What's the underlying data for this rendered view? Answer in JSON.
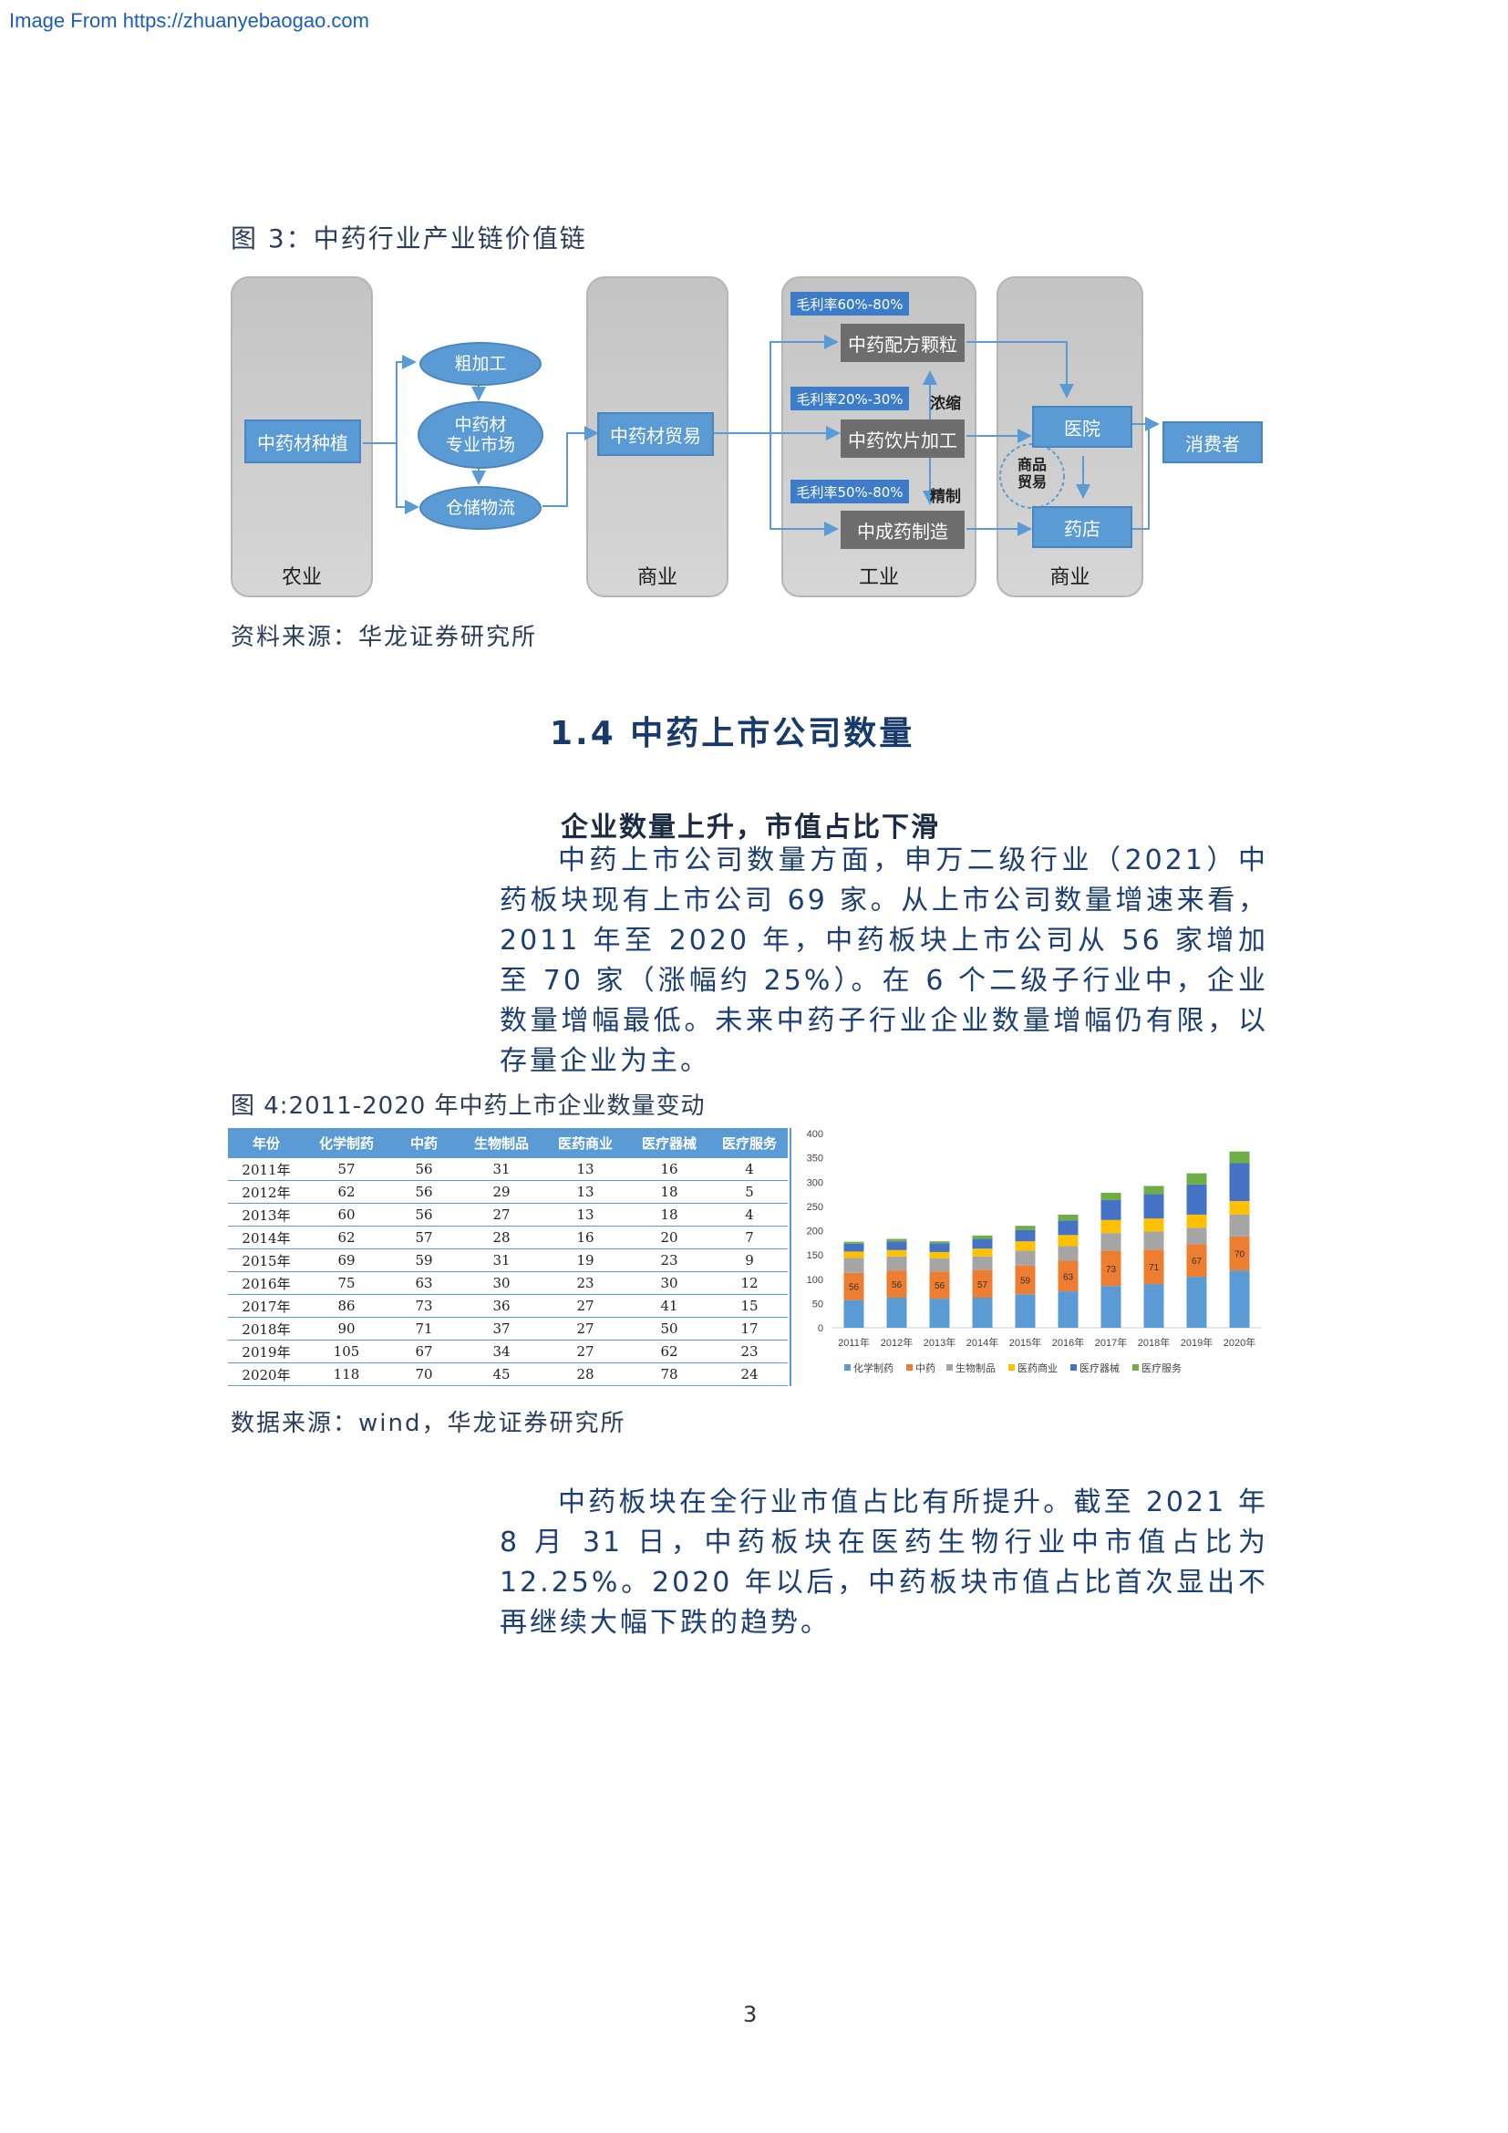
{
  "watermark": "Image From https://zhuanyebaogao.com",
  "figure3": {
    "title": "图 3：中药行业产业链价值链",
    "source": "资料来源：华龙证券研究所",
    "columns": [
      "农业",
      "商业",
      "工业",
      "商业"
    ],
    "nodes": {
      "planting": "中药材种植",
      "rough": "粗加工",
      "market_line1": "中药材",
      "market_line2": "专业市场",
      "storage": "仓储物流",
      "trade": "中药材贸易",
      "granules": "中药配方颗粒",
      "slices": "中药饮片加工",
      "patent": "中成药制造",
      "hospital": "医院",
      "pharmacy": "药店",
      "consumer": "消费者",
      "goods_line1": "商品",
      "goods_line2": "贸易"
    },
    "margins": [
      "毛利率60%-80%",
      "毛利率20%-30%",
      "毛利率50%-80%"
    ],
    "process_labels": [
      "浓缩",
      "精制"
    ]
  },
  "section": {
    "title": "1.4 中药上市公司数量",
    "subhead": "企业数量上升，市值占比下滑",
    "paragraph1": "中药上市公司数量方面，申万二级行业（2021）中药板块现有上市公司 69 家。从上市公司数量增速来看，2011 年至 2020 年，中药板块上市公司从 56 家增加至 70 家（涨幅约 25%）。在 6 个二级子行业中，企业数量增幅最低。未来中药子行业企业数量增幅仍有限，以存量企业为主。"
  },
  "figure4": {
    "title": "图 4:2011-2020 年中药上市企业数量变动",
    "source": "数据来源：wind，华龙证券研究所",
    "table": {
      "headers": [
        "年份",
        "化学制药",
        "中药",
        "生物制品",
        "医药商业",
        "医疗器械",
        "医疗服务"
      ],
      "rows": [
        [
          "2011年",
          "57",
          "56",
          "31",
          "13",
          "16",
          "4"
        ],
        [
          "2012年",
          "62",
          "56",
          "29",
          "13",
          "18",
          "5"
        ],
        [
          "2013年",
          "60",
          "56",
          "27",
          "13",
          "18",
          "4"
        ],
        [
          "2014年",
          "62",
          "57",
          "28",
          "16",
          "20",
          "7"
        ],
        [
          "2015年",
          "69",
          "59",
          "31",
          "19",
          "23",
          "9"
        ],
        [
          "2016年",
          "75",
          "63",
          "30",
          "23",
          "30",
          "12"
        ],
        [
          "2017年",
          "86",
          "73",
          "36",
          "27",
          "41",
          "15"
        ],
        [
          "2018年",
          "90",
          "71",
          "37",
          "27",
          "50",
          "17"
        ],
        [
          "2019年",
          "105",
          "67",
          "34",
          "27",
          "62",
          "23"
        ],
        [
          "2020年",
          "118",
          "70",
          "45",
          "28",
          "78",
          "24"
        ]
      ]
    }
  },
  "chart_data": {
    "type": "bar",
    "stacked": true,
    "categories": [
      "2011年",
      "2012年",
      "2013年",
      "2014年",
      "2015年",
      "2016年",
      "2017年",
      "2018年",
      "2019年",
      "2020年"
    ],
    "ylim": [
      0,
      400
    ],
    "yticks": [
      "400",
      "350",
      "300",
      "250",
      "200",
      "150",
      "100",
      "50",
      "0"
    ],
    "legend_position": "bottom",
    "series": [
      {
        "name": "化学制药",
        "color": "#5b9bd5",
        "values": [
          57,
          62,
          60,
          62,
          69,
          75,
          86,
          90,
          105,
          118
        ]
      },
      {
        "name": "中药",
        "color": "#ed7d31",
        "values": [
          56,
          56,
          56,
          57,
          59,
          63,
          73,
          71,
          67,
          70
        ],
        "labels": [
          "56",
          "56",
          "56",
          "57",
          "59",
          "63",
          "73",
          "71",
          "67",
          "70"
        ]
      },
      {
        "name": "生物制品",
        "color": "#a5a5a5",
        "values": [
          31,
          29,
          27,
          28,
          31,
          30,
          36,
          37,
          34,
          45
        ]
      },
      {
        "name": "医药商业",
        "color": "#ffc000",
        "values": [
          13,
          13,
          13,
          16,
          19,
          23,
          27,
          27,
          27,
          28
        ]
      },
      {
        "name": "医疗器械",
        "color": "#4472c4",
        "values": [
          16,
          18,
          18,
          20,
          23,
          30,
          41,
          50,
          62,
          78
        ]
      },
      {
        "name": "医疗服务",
        "color": "#70ad47",
        "values": [
          4,
          5,
          4,
          7,
          9,
          12,
          15,
          17,
          23,
          24
        ]
      }
    ]
  },
  "closing": {
    "paragraph2": "中药板块在全行业市值占比有所提升。截至 2021 年 8 月 31 日，中药板块在医药生物行业中市值占比为 12.25%。2020 年以后，中药板块市值占比首次显出不再继续大幅下跌的趋势。"
  },
  "page_number": "3"
}
